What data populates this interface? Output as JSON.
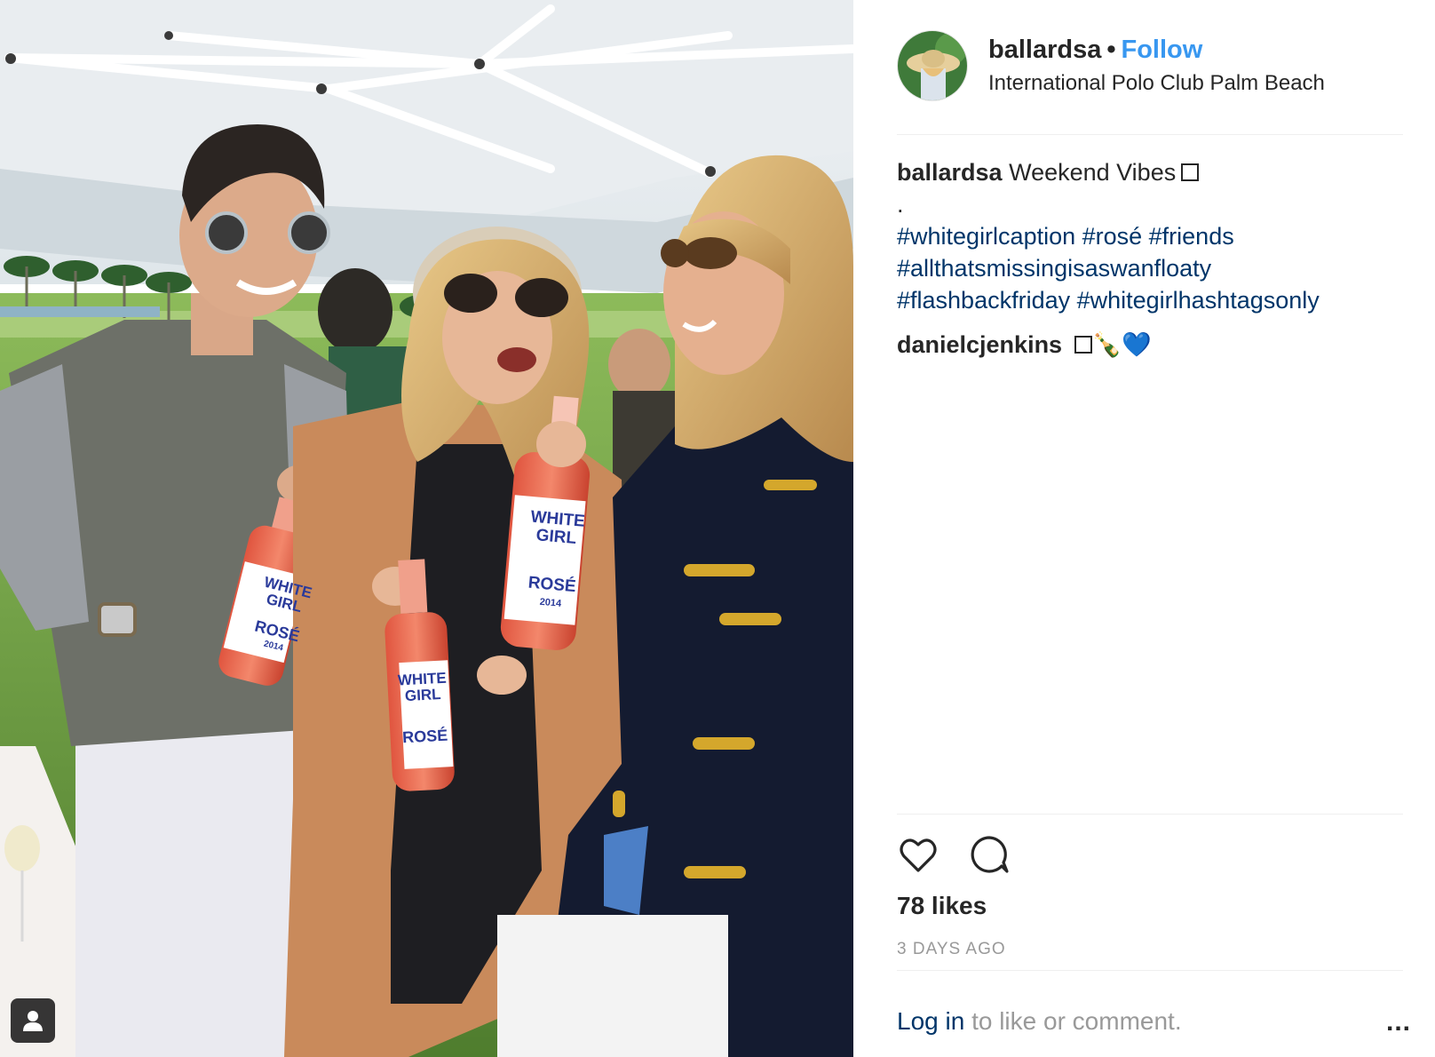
{
  "post": {
    "username": "ballardsa",
    "separator": "•",
    "follow_label": "Follow",
    "location": "International Polo Club Palm Beach"
  },
  "caption": {
    "username": "ballardsa",
    "text": "Weekend Vibes",
    "dot_line": ".",
    "hashtags_line1": "#whitegirlcaption #rosé #friends",
    "hashtags_line2": "#allthatsmissingisaswanfloaty",
    "hashtags_line3": "#flashbackfriday #whitegirlhashtagsonly"
  },
  "comments": [
    {
      "username": "danielcjenkins",
      "emoji": "🍾💙"
    }
  ],
  "stats": {
    "likes": "78 likes",
    "timestamp": "3 DAYS AGO"
  },
  "footer": {
    "login_link": "Log in",
    "login_suffix": " to like or comment.",
    "more_label": "..."
  },
  "photo": {
    "bottle_label_top": "WHITE",
    "bottle_label_mid": "GIRL",
    "bottle_label_bottom": "ROSÉ",
    "bottle_year": "2014"
  },
  "icons": {
    "heart": "heart-icon",
    "comment": "comment-icon",
    "tag": "user-tag-icon",
    "more": "more-options-icon"
  },
  "colors": {
    "link": "#3897f0",
    "hashtag": "#003569",
    "muted": "#999999",
    "text": "#262626"
  }
}
